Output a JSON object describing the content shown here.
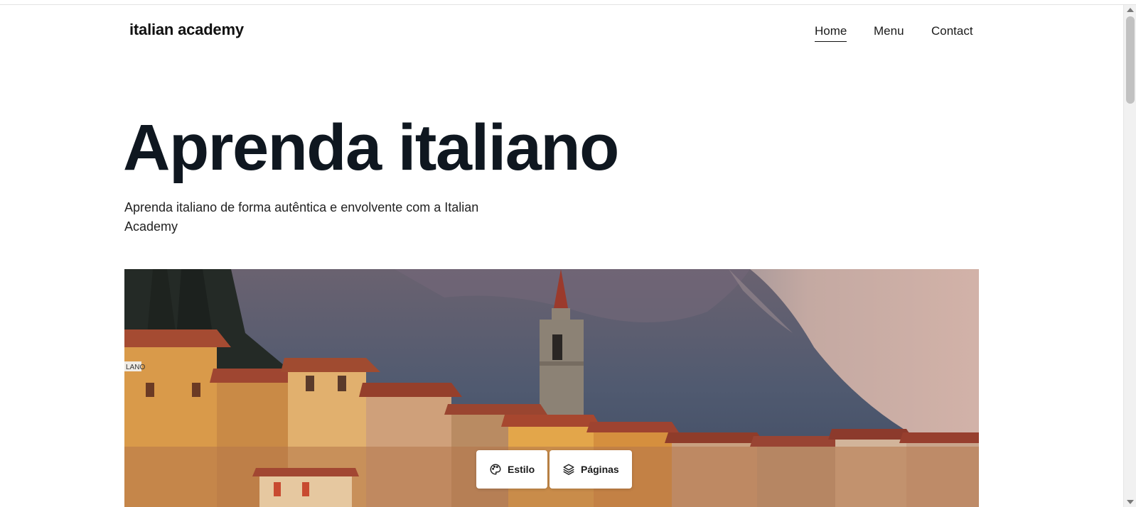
{
  "site": {
    "brand": "italian academy"
  },
  "nav": {
    "items": [
      {
        "label": "Home",
        "active": true
      },
      {
        "label": "Menu",
        "active": false
      },
      {
        "label": "Contact",
        "active": false
      }
    ]
  },
  "hero": {
    "title": "Aprenda italiano",
    "subtitle": "Aprenda italiano de forma autêntica e envolvente com a Italian Academy",
    "image": {
      "subject": "Italian lakeside village with bell tower and mountain at dusk",
      "sign_text": "LANO"
    }
  },
  "floating_buttons": [
    {
      "label": "Estilo",
      "icon": "palette-icon"
    },
    {
      "label": "Páginas",
      "icon": "layers-icon"
    }
  ],
  "colors": {
    "title": "#0f1720",
    "text": "#222222",
    "background": "#ffffff"
  }
}
